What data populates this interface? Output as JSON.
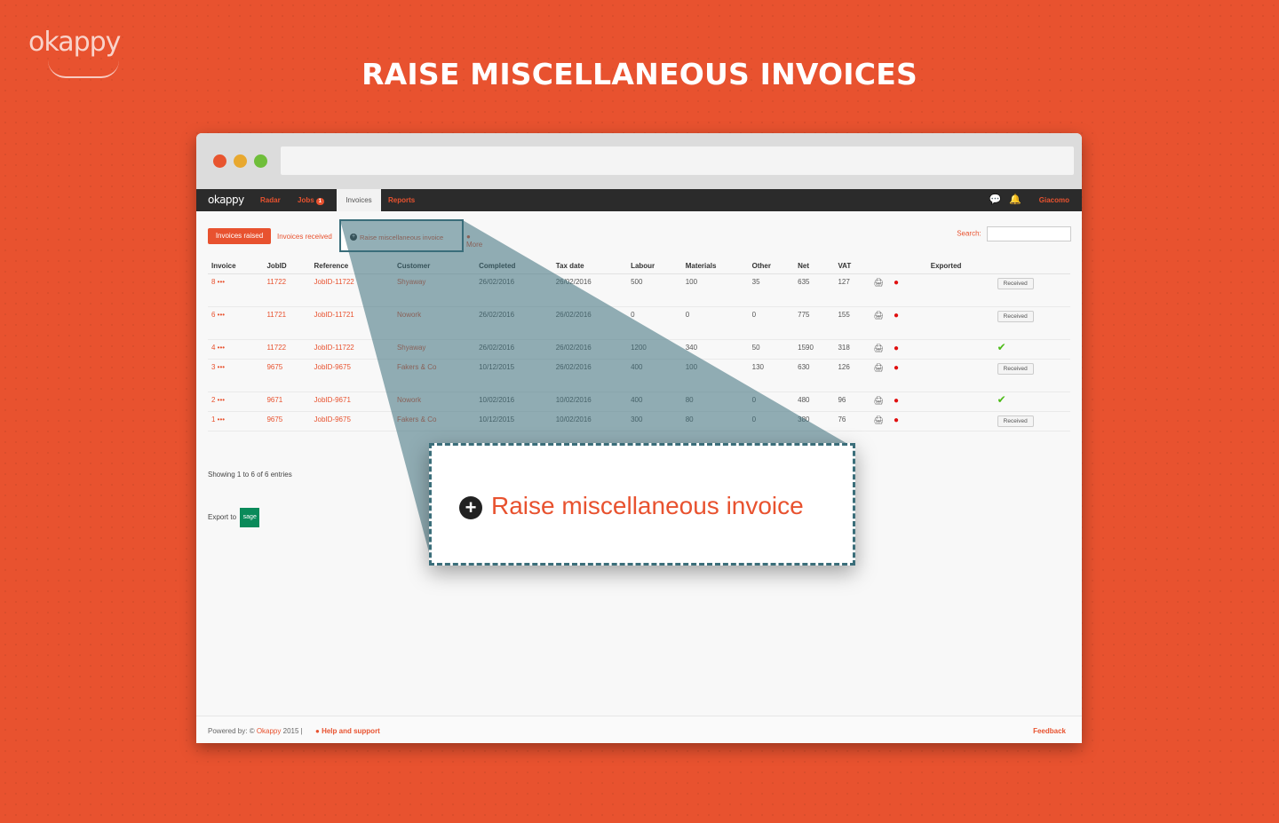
{
  "brand": {
    "logo": "okappy"
  },
  "hero": {
    "title": "RAISE MISCELLANEOUS INVOICES"
  },
  "app": {
    "logo": "okappy",
    "nav": {
      "radar": "Radar",
      "jobs": "Jobs",
      "jobs_badge": "1",
      "invoices": "Invoices",
      "reports": "Reports"
    },
    "user": "Giacomo",
    "icons": [
      "chat-icon",
      "bell-icon"
    ]
  },
  "toolbar": {
    "invoices_raised": "Invoices raised",
    "invoices_received": "Invoices received",
    "raise_misc": "Raise miscellaneous invoice",
    "more": "More",
    "search_label": "Search:"
  },
  "table": {
    "headers": [
      "Invoice",
      "JobID",
      "Reference",
      "Customer",
      "Completed",
      "Tax date",
      "Labour",
      "Materials",
      "Other",
      "Net",
      "VAT",
      "",
      "Exported",
      ""
    ],
    "rows": [
      {
        "invoice": "8 •••",
        "jobid": "11722",
        "reference": "JobID-11722",
        "customer": "Shyaway",
        "completed": "26/02/2016",
        "taxdate": "26/02/2016",
        "labour": "500",
        "materials": "100",
        "other": "35",
        "net": "635",
        "vat": "127",
        "status": "Received",
        "size": "tall"
      },
      {
        "invoice": "6 •••",
        "jobid": "11721",
        "reference": "JobID-11721",
        "customer": "Nowork",
        "completed": "26/02/2016",
        "taxdate": "26/02/2016",
        "labour": "0",
        "materials": "0",
        "other": "0",
        "net": "775",
        "vat": "155",
        "status": "Received",
        "size": "tall"
      },
      {
        "invoice": "4 •••",
        "jobid": "11722",
        "reference": "JobID-11722",
        "customer": "Shyaway",
        "completed": "26/02/2016",
        "taxdate": "26/02/2016",
        "labour": "1200",
        "materials": "340",
        "other": "50",
        "net": "1590",
        "vat": "318",
        "status": "check",
        "size": "short"
      },
      {
        "invoice": "3 •••",
        "jobid": "9675",
        "reference": "JobID-9675",
        "customer": "Fakers & Co",
        "completed": "10/12/2015",
        "taxdate": "26/02/2016",
        "labour": "400",
        "materials": "100",
        "other": "130",
        "net": "630",
        "vat": "126",
        "status": "Received",
        "size": "tall"
      },
      {
        "invoice": "2 •••",
        "jobid": "9671",
        "reference": "JobID-9671",
        "customer": "Nowork",
        "completed": "10/02/2016",
        "taxdate": "10/02/2016",
        "labour": "400",
        "materials": "80",
        "other": "0",
        "net": "480",
        "vat": "96",
        "status": "check",
        "size": "short"
      },
      {
        "invoice": "1 •••",
        "jobid": "9675",
        "reference": "JobID-9675",
        "customer": "Fakers & Co",
        "completed": "10/12/2015",
        "taxdate": "10/02/2016",
        "labour": "300",
        "materials": "80",
        "other": "0",
        "net": "380",
        "vat": "76",
        "status": "Received",
        "size": "short"
      }
    ]
  },
  "showing": "Showing 1 to 6 of 6 entries",
  "export": {
    "label": "Export to",
    "sage": "sage"
  },
  "footer": {
    "powered_prefix": "Powered by: © ",
    "powered_link": "Okappy",
    "powered_suffix": " 2015  |",
    "help": "Help and support",
    "feedback": "Feedback"
  },
  "zoom": {
    "text": "Raise miscellaneous invoice"
  },
  "colors": {
    "accent": "#e8522f",
    "highlight": "#3b6e7a",
    "appbar": "#2b2b2b"
  }
}
